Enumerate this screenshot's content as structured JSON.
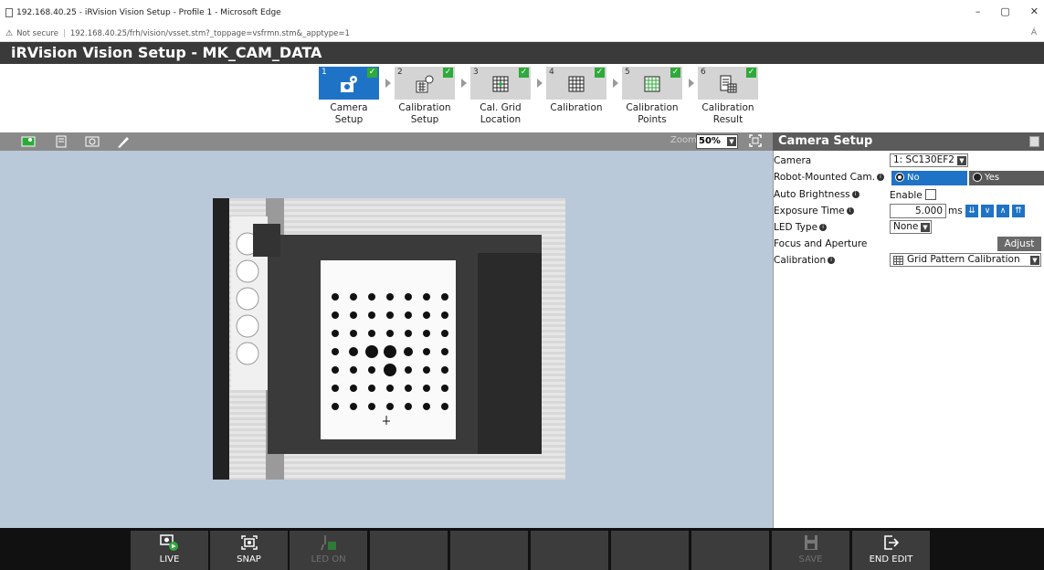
{
  "browser": {
    "tab_title": "192.168.40.25 - iRVision Vision Setup - Profile 1 - Microsoft Edge",
    "security": "Not secure",
    "url": "192.168.40.25/frh/vision/vsset.stm?_toppage=vsfrmn.stm&_apptype=1",
    "minimize": "–",
    "restore": "▢",
    "close": "✕",
    "read_aloud": "Á"
  },
  "app": {
    "title": "iRVision Vision Setup - MK_CAM_DATA"
  },
  "steps": [
    {
      "num": "1",
      "label": "Camera Setup"
    },
    {
      "num": "2",
      "label": "Calibration Setup"
    },
    {
      "num": "3",
      "label": "Cal. Grid Location"
    },
    {
      "num": "4",
      "label": "Calibration"
    },
    {
      "num": "5",
      "label": "Calibration Points"
    },
    {
      "num": "6",
      "label": "Calibration Result"
    }
  ],
  "step_check": "✓",
  "toolbar": {
    "zoom_label": "Zoom",
    "zoom_value": "50%"
  },
  "panel": {
    "title": "Camera Setup",
    "camera_label": "Camera",
    "camera_value": "1: SC130EF2",
    "robot_mounted_label": "Robot-Mounted Cam.",
    "robot_mounted_no": "No",
    "robot_mounted_yes": "Yes",
    "auto_brightness_label": "Auto Brightness",
    "auto_brightness_enable": "Enable",
    "exposure_label": "Exposure Time",
    "exposure_value": "5.000",
    "exposure_unit": "ms",
    "led_label": "LED Type",
    "led_value": "None",
    "focus_label": "Focus and Aperture",
    "adjust_button": "Adjust",
    "calibration_label": "Calibration",
    "calibration_value": "Grid Pattern Calibration"
  },
  "bottom": {
    "live": "LIVE",
    "snap": "SNAP",
    "led_on": "LED ON",
    "save": "SAVE",
    "end_edit": "END EDIT"
  },
  "colors": {
    "accent": "#1f73c7",
    "check": "#2eaa3a",
    "header": "#3a3a3a",
    "canvas_bg": "#b9c9d9"
  }
}
